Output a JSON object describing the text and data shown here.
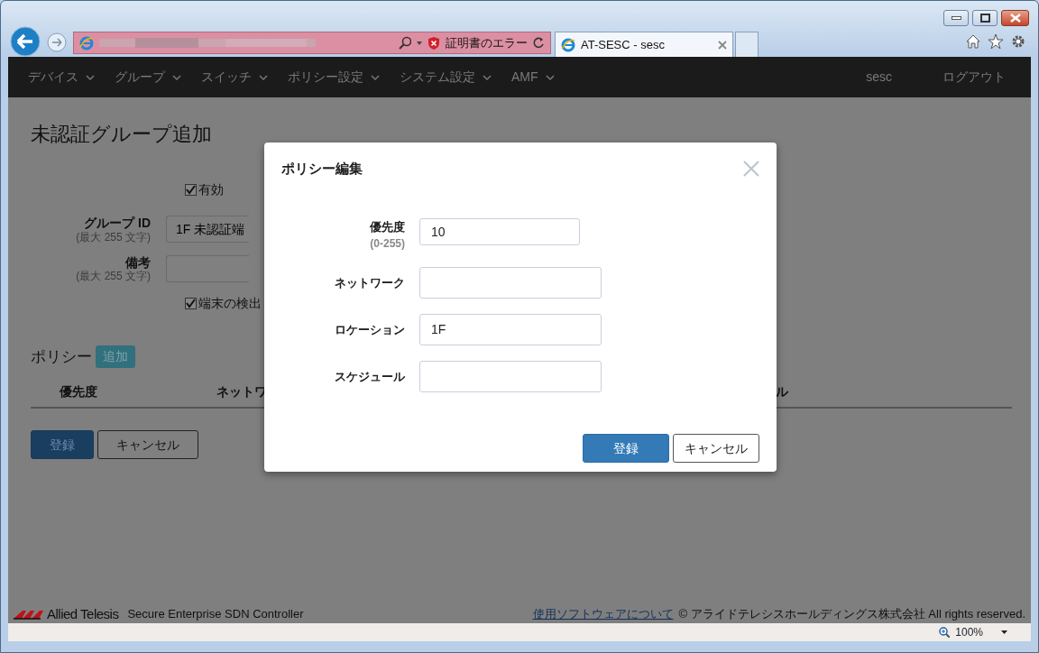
{
  "browser": {
    "cert_error": "証明書のエラー",
    "tab_title": "AT-SESC - sesc",
    "zoom": "100%"
  },
  "navbar": {
    "menus": [
      {
        "label": "デバイス"
      },
      {
        "label": "グループ"
      },
      {
        "label": "スイッチ"
      },
      {
        "label": "ポリシー設定"
      },
      {
        "label": "システム設定"
      },
      {
        "label": "AMF"
      }
    ],
    "user": "sesc",
    "logout": "ログアウト"
  },
  "page": {
    "title": "未認証グループ追加",
    "checks": [
      {
        "label": "有効",
        "checked": true
      }
    ],
    "fields": [
      {
        "label": "グループ ID",
        "hint": "(最大 255 文字)",
        "value": "1F 未認証端"
      },
      {
        "label": "備考",
        "hint": "(最大 255 文字)"
      }
    ],
    "checks_2": [
      {
        "label": "端末の検出",
        "checked": true
      }
    ],
    "policy": {
      "heading": "ポリシー",
      "add": "追加",
      "columns": [
        "優先度",
        "ネットワ",
        "ル"
      ]
    },
    "buttons": [
      {
        "label": "登録",
        "kind": "primary"
      },
      {
        "label": "キャンセル",
        "kind": "default"
      }
    ]
  },
  "modal": {
    "title": "ポリシー編集",
    "fields": [
      {
        "label": "優先度",
        "hint": "(0-255)",
        "value": "10",
        "kind": "short"
      },
      {
        "label": "ネットワーク",
        "kind": "long"
      },
      {
        "label": "ロケーション",
        "value": "1F",
        "kind": "long"
      },
      {
        "label": "スケジュール",
        "kind": "long"
      }
    ],
    "buttons": [
      {
        "label": "登録",
        "kind": "primary"
      },
      {
        "label": "キャンセル",
        "kind": "default"
      }
    ]
  },
  "footer": {
    "brand": "Allied Telesis",
    "product": "Secure Enterprise SDN Controller",
    "link": "使用ソフトウェアについて",
    "copyright": "© アライドテレシスホールディングス株式会社 All rights reserved."
  }
}
